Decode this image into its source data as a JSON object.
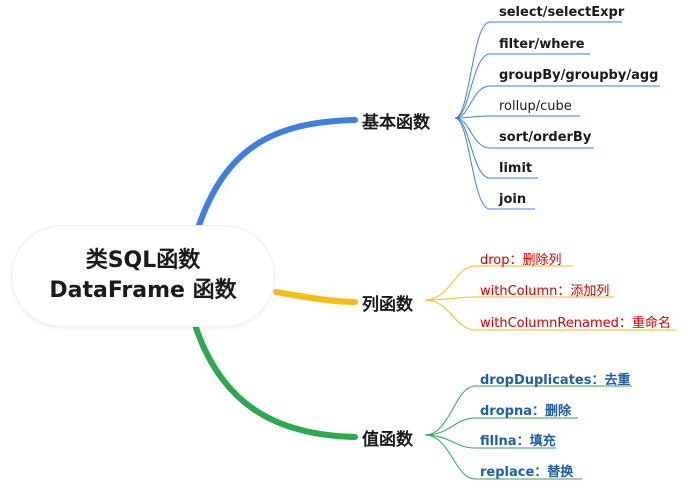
{
  "root": {
    "line1": "类SQL函数",
    "line2": "DataFrame 函数"
  },
  "branches": [
    {
      "label": "基本函数",
      "color": "#3f7fe0",
      "text_color": "#1a1a1a",
      "leaves": [
        "select/selectExpr",
        "filter/where",
        "groupBy/groupby/agg",
        "rollup/cube",
        "sort/orderBy",
        "limit",
        "join"
      ]
    },
    {
      "label": "列函数",
      "color": "#f6bd16",
      "text_color": "#d40000",
      "leaves": [
        "drop：删除列",
        "withColumn：添加列",
        "withColumnRenamed：重命名"
      ]
    },
    {
      "label": "值函数",
      "color": "#2ea84f",
      "text_color": "#1f5fa8",
      "leaves": [
        "dropDuplicates：去重",
        "dropna：删除",
        "fillna：填充",
        "replace：替换"
      ]
    }
  ]
}
